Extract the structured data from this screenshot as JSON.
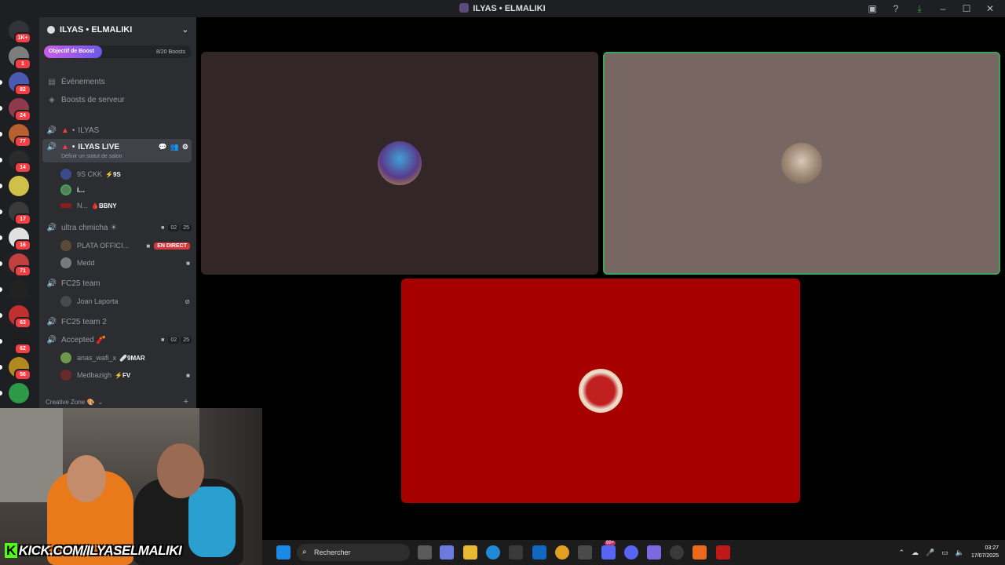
{
  "window": {
    "title": "ILYAS • ELMALIKI"
  },
  "rail": {
    "servers": [
      {
        "badge": "1K+",
        "color": "#313338"
      },
      {
        "badge": "1",
        "color": "#7d7d7d"
      },
      {
        "badge": "82",
        "color": "#4a5ab0"
      },
      {
        "badge": "24",
        "color": "#8f3a4a"
      },
      {
        "badge": "77",
        "color": "#b86030"
      },
      {
        "badge": "14",
        "color": "#2a2a2a"
      },
      {
        "badge": "",
        "color": "#d0c04a"
      },
      {
        "badge": "17",
        "color": "#3a3a3a"
      },
      {
        "badge": "16",
        "color": "#e0e0e0"
      },
      {
        "badge": "71",
        "color": "#c04040"
      },
      {
        "badge": "",
        "color": "#222"
      },
      {
        "badge": "63",
        "color": "#c03030"
      },
      {
        "badge": "62",
        "color": "#1e1e1e"
      },
      {
        "badge": "56",
        "color": "#b08a20"
      },
      {
        "badge": "",
        "color": "#2d9a4a"
      }
    ]
  },
  "sidebar": {
    "guild_name": "ILYAS • ELMALIKI",
    "boost_label": "Objectif de Boost",
    "boost_count": "8/20 Boosts",
    "events": "Événements",
    "server_boosts": "Boosts de serveur",
    "channels": {
      "ilyas": "ILYAS",
      "ilyas_live": "ILYAS LIVE",
      "ilyas_live_status": "Définir un statut de salon",
      "ultra": "ultra chmicha ☀",
      "ultra_counts": [
        "02",
        "25"
      ],
      "fc25": "FC25 team",
      "fc25_2": "FC25 team 2",
      "accepted": "Accepted 🧨",
      "accepted_counts": [
        "02",
        "25"
      ],
      "creative": "Creative Zone 🎨"
    },
    "users": {
      "u1": "9S CKK",
      "u1_tag": "⚡9S",
      "u2": "i...",
      "u3": "N...",
      "u3_tag": "🩸BBNY",
      "u4": "PLATA OFFICI...",
      "u4_live": "EN DIRECT",
      "u5": "Medd",
      "u6": "Joan Laporta",
      "u7": "anas_wafi_x",
      "u7_tag": "🩹9MAR",
      "u8": "Medbazigh",
      "u8_tag": "⚡FV"
    }
  },
  "overlay": {
    "kick_text": "KICK.COM/ILYASELMALIKI"
  },
  "taskbar": {
    "search_placeholder": "Rechercher",
    "time": "03:27",
    "date": "17/07/2025",
    "notif_badge": "99+"
  },
  "colors": {
    "tile1": "#322629",
    "tile2": "#776661",
    "tile3": "#a60000",
    "speaking": "#3ba55c"
  }
}
